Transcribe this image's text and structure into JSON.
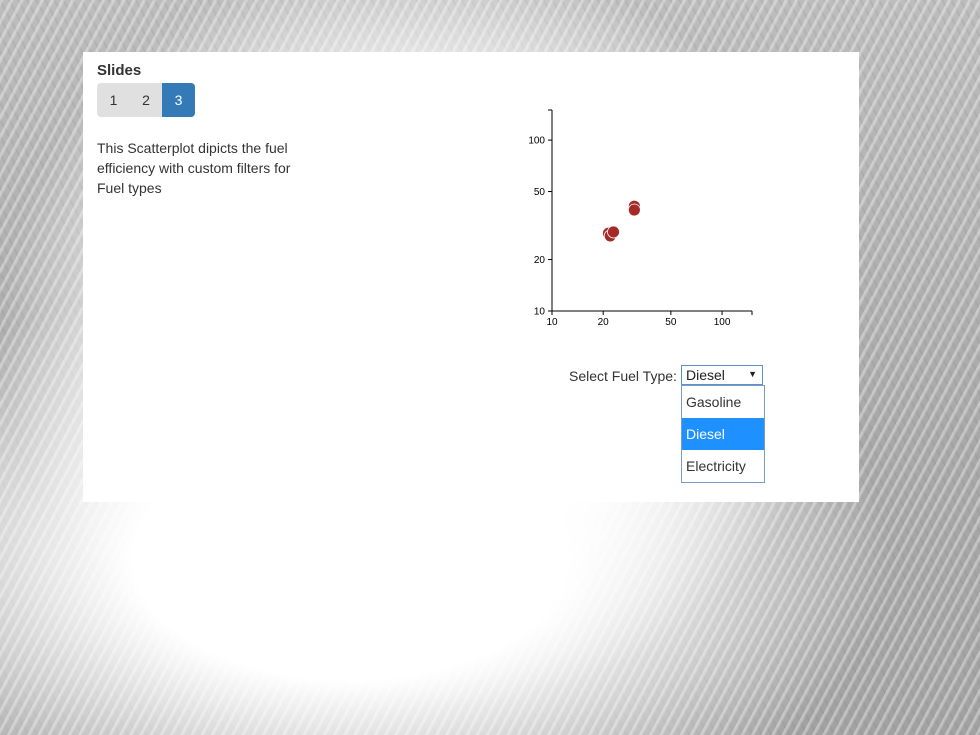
{
  "slides": {
    "title": "Slides",
    "pages": [
      "1",
      "2",
      "3"
    ],
    "active_page": "3"
  },
  "description": "This Scatterplot dipicts the fuel efficiency with custom filters for Fuel types",
  "fuel_filter": {
    "label": "Select Fuel Type:",
    "selected": "Diesel",
    "options": [
      "Gasoline",
      "Diesel",
      "Electricity"
    ]
  },
  "colors": {
    "accent": "#337ab7",
    "highlight": "#1e90ff",
    "point": "#a52a2a"
  },
  "chart_data": {
    "type": "scatter",
    "x_scale": "log",
    "y_scale": "log",
    "xlim": [
      10,
      150
    ],
    "ylim": [
      10,
      150
    ],
    "x_ticks": [
      10,
      20,
      50,
      100
    ],
    "y_ticks": [
      10,
      20,
      50,
      100
    ],
    "x_tick_labels": [
      "10",
      "20",
      "50",
      "100"
    ],
    "y_tick_labels": [
      "10",
      "20",
      "50",
      "100"
    ],
    "grid": false,
    "series": [
      {
        "points": [
          {
            "x": 21.5,
            "y": 28.5
          },
          {
            "x": 22.0,
            "y": 27.5
          },
          {
            "x": 23.0,
            "y": 29.0
          },
          {
            "x": 30.5,
            "y": 41.0
          },
          {
            "x": 30.5,
            "y": 39.0
          }
        ]
      }
    ]
  }
}
